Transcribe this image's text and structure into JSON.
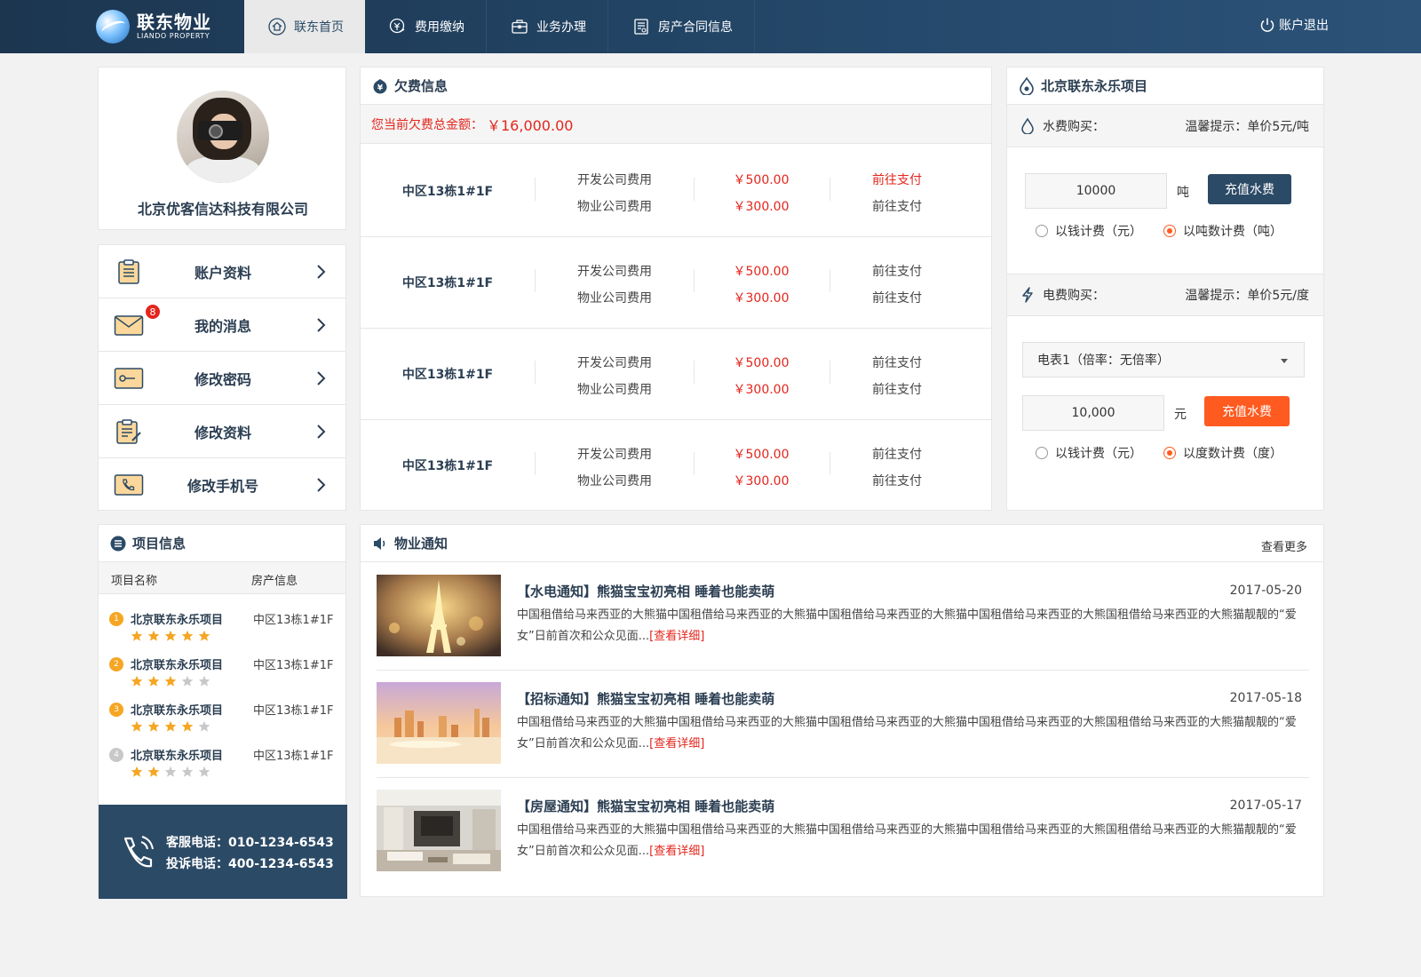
{
  "brand": {
    "name_cn": "联东物业",
    "name_en": "LIANDO PROPERTY"
  },
  "nav": [
    {
      "label": "联东首页",
      "icon": "home-icon",
      "active": true
    },
    {
      "label": "费用缴纳",
      "icon": "payment-icon",
      "active": false
    },
    {
      "label": "业务办理",
      "icon": "briefcase-icon",
      "active": false
    },
    {
      "label": "房产合同信息",
      "icon": "contract-icon",
      "active": false
    }
  ],
  "logout_label": "账户退出",
  "profile": {
    "company": "北京优客信达科技有限公司"
  },
  "menu": [
    {
      "label": "账户资料",
      "icon": "clipboard-icon"
    },
    {
      "label": "我的消息",
      "icon": "envelope-icon",
      "badge": "8"
    },
    {
      "label": "修改密码",
      "icon": "key-icon"
    },
    {
      "label": "修改资料",
      "icon": "edit-icon"
    },
    {
      "label": "修改手机号",
      "icon": "phone-icon"
    }
  ],
  "arrears": {
    "title": "欠费信息",
    "total_label": "您当前欠费总金额：",
    "total_amount": "￥16,000.00",
    "rows": [
      {
        "location": "中区13栋1#1F",
        "fee1": "开发公司费用",
        "amt1": "￥500.00",
        "pay1": "前往支付",
        "fee2": "物业公司费用",
        "amt2": "￥300.00",
        "pay2": "前往支付"
      },
      {
        "location": "中区13栋1#1F",
        "fee1": "开发公司费用",
        "amt1": "￥500.00",
        "pay1": "前往支付",
        "fee2": "物业公司费用",
        "amt2": "￥300.00",
        "pay2": "前往支付"
      },
      {
        "location": "中区13栋1#1F",
        "fee1": "开发公司费用",
        "amt1": "￥500.00",
        "pay1": "前往支付",
        "fee2": "物业公司费用",
        "amt2": "￥300.00",
        "pay2": "前往支付"
      },
      {
        "location": "中区13栋1#1F",
        "fee1": "开发公司费用",
        "amt1": "￥500.00",
        "pay1": "前往支付",
        "fee2": "物业公司费用",
        "amt2": "￥300.00",
        "pay2": "前往支付"
      }
    ]
  },
  "project": {
    "title": "北京联东永乐项目",
    "water": {
      "label": "水费购买：",
      "hint": "温馨提示：单价5元/吨",
      "value": "10000",
      "unit": "吨",
      "button": "充值水费",
      "opt1": "以钱计费（元）",
      "opt2": "以吨数计费（吨）"
    },
    "electric": {
      "label": "电费购买：",
      "hint": "温馨提示：单价5元/度",
      "meter": "电表1（倍率：无倍率）",
      "value": "10,000",
      "unit": "元",
      "button": "充值水费",
      "opt1": "以钱计费（元）",
      "opt2": "以度数计费（度）"
    }
  },
  "pinfo": {
    "title": "项目信息",
    "col1": "项目名称",
    "col2": "房产信息",
    "rows": [
      {
        "num": "1",
        "name": "北京联东永乐项目",
        "loc": "中区13栋1#1F",
        "rating": 5,
        "color": "#f5a623"
      },
      {
        "num": "2",
        "name": "北京联东永乐项目",
        "loc": "中区13栋1#1F",
        "rating": 3,
        "color": "#f5a623"
      },
      {
        "num": "3",
        "name": "北京联东永乐项目",
        "loc": "中区13栋1#1F",
        "rating": 4,
        "color": "#f5a623"
      },
      {
        "num": "4",
        "name": "北京联东永乐项目",
        "loc": "中区13栋1#1F",
        "rating": 2,
        "color": "#c8c8c8"
      }
    ],
    "service_phone": "客服电话：010-1234-6543",
    "complaint_phone": "投诉电话：400-1234-6543"
  },
  "notices": {
    "title": "物业通知",
    "more": "查看更多",
    "items": [
      {
        "title": "【水电通知】熊猫宝宝初亮相 睡着也能卖萌",
        "date": "2017-05-20",
        "body": "中国租借给马来西亚的大熊猫中国租借给马来西亚的大熊猫中国租借给马来西亚的大熊猫中国租借给马来西亚的大熊国租借给马来西亚的大熊猫靓靓的“爱女”日前首次和公众见面...",
        "link": "[查看详细]",
        "image": "eiffel-tower-night"
      },
      {
        "title": "【招标通知】熊猫宝宝初亮相 睡着也能卖萌",
        "date": "2017-05-18",
        "body": "中国租借给马来西亚的大熊猫中国租借给马来西亚的大熊猫中国租借给马来西亚的大熊猫中国租借给马来西亚的大熊国租借给马来西亚的大熊猫靓靓的“爱女”日前首次和公众见面...",
        "link": "[查看详细]",
        "image": "city-skyline"
      },
      {
        "title": "【房屋通知】熊猫宝宝初亮相 睡着也能卖萌",
        "date": "2017-05-17",
        "body": "中国租借给马来西亚的大熊猫中国租借给马来西亚的大熊猫中国租借给马来西亚的大熊猫中国租借给马来西亚的大熊国租借给马来西亚的大熊猫靓靓的“爱女”日前首次和公众见面...",
        "link": "[查看详细]",
        "image": "living-room"
      }
    ]
  },
  "colors": {
    "primary": "#2b4a66",
    "accent_red": "#e3251c",
    "accent_orange": "#ff5a1f",
    "star": "#f5a623"
  }
}
